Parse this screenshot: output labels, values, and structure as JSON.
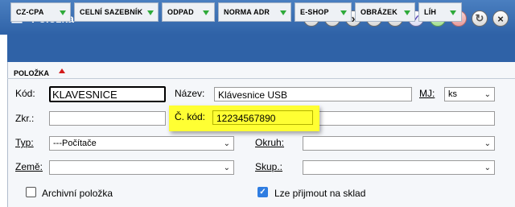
{
  "window": {
    "title": "Položka"
  },
  "toolbar": {
    "first": "K",
    "prev": "‹",
    "next": "›",
    "last": ">I",
    "list": "≡",
    "confirm": "✓",
    "add": "+",
    "remove": "−",
    "refresh": "↻",
    "close": "×"
  },
  "tabs": [
    "CZ-CPA",
    "CELNÍ SAZEBNÍK",
    "ODPAD",
    "NORMA ADR",
    "E-SHOP",
    "OBRÁZEK",
    "LÍH"
  ],
  "subtab": {
    "label": "POLOŽKA"
  },
  "form": {
    "kod_label": "Kód:",
    "kod_value": "KLAVESNICE",
    "nazev_label": "Název:",
    "nazev_value": "Klávesnice USB",
    "mj_label": "MJ:",
    "mj_value": "ks",
    "zkr_label": "Zkr.:",
    "zkr_value": "",
    "ckod_label": "Č. kód:",
    "ckod_value": "12234567890",
    "typ_label": "Typ:",
    "typ_value": "---Počítače",
    "okruh_label": "Okruh:",
    "okruh_value": "",
    "zeme_label": "Země:",
    "zeme_value": "",
    "skup_label": "Skup.:",
    "skup_value": "",
    "archiv_label": "Archivní položka",
    "archiv_checked": false,
    "sklad_label": "Lze přijmout na sklad",
    "sklad_checked": true
  },
  "colors": {
    "titlebar": "#3a6fb5",
    "highlight": "#ffff33",
    "tab_arrow": "#2faa3a",
    "subtab_arrow": "#d31b1b"
  }
}
